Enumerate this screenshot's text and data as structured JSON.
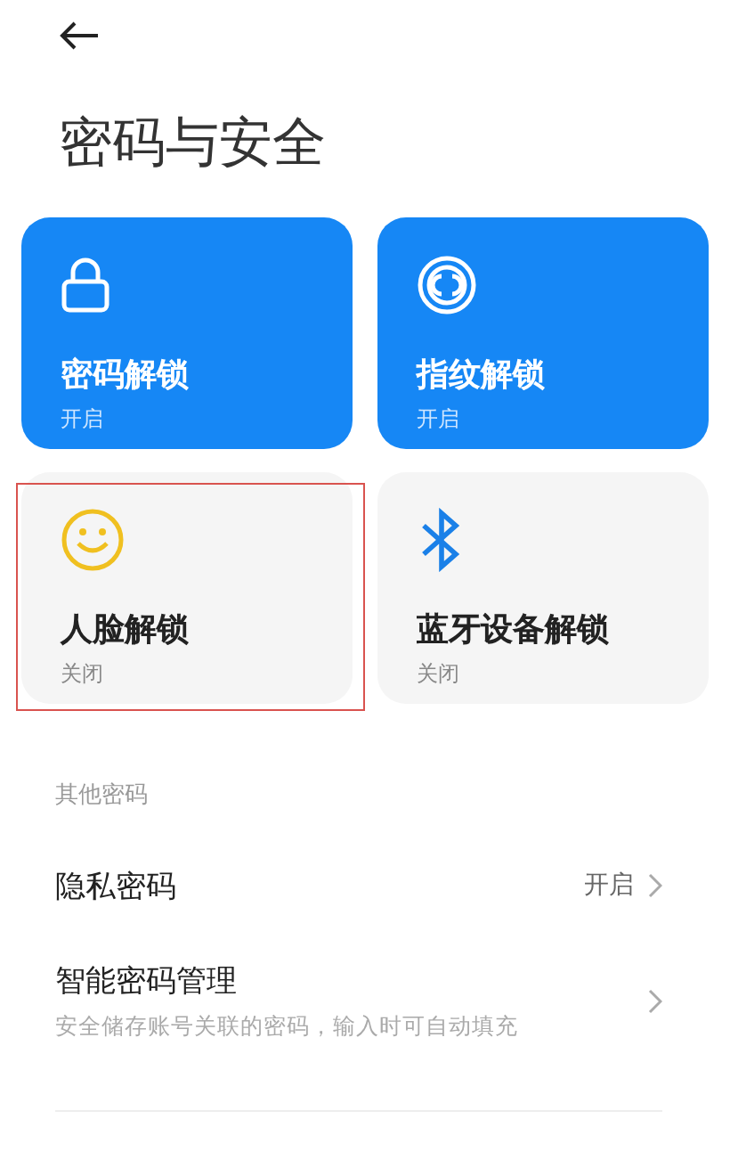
{
  "title": "密码与安全",
  "unlock_cards": [
    {
      "label": "密码解锁",
      "status": "开启",
      "on": true,
      "highlighted": false
    },
    {
      "label": "指纹解锁",
      "status": "开启",
      "on": true,
      "highlighted": false
    },
    {
      "label": "人脸解锁",
      "status": "关闭",
      "on": false,
      "highlighted": true
    },
    {
      "label": "蓝牙设备解锁",
      "status": "关闭",
      "on": false,
      "highlighted": false
    }
  ],
  "section_label": "其他密码",
  "rows": [
    {
      "label": "隐私密码",
      "value": "开启"
    },
    {
      "label": "智能密码管理",
      "subtitle": "安全储存账号关联的密码，输入时可自动填充"
    }
  ]
}
